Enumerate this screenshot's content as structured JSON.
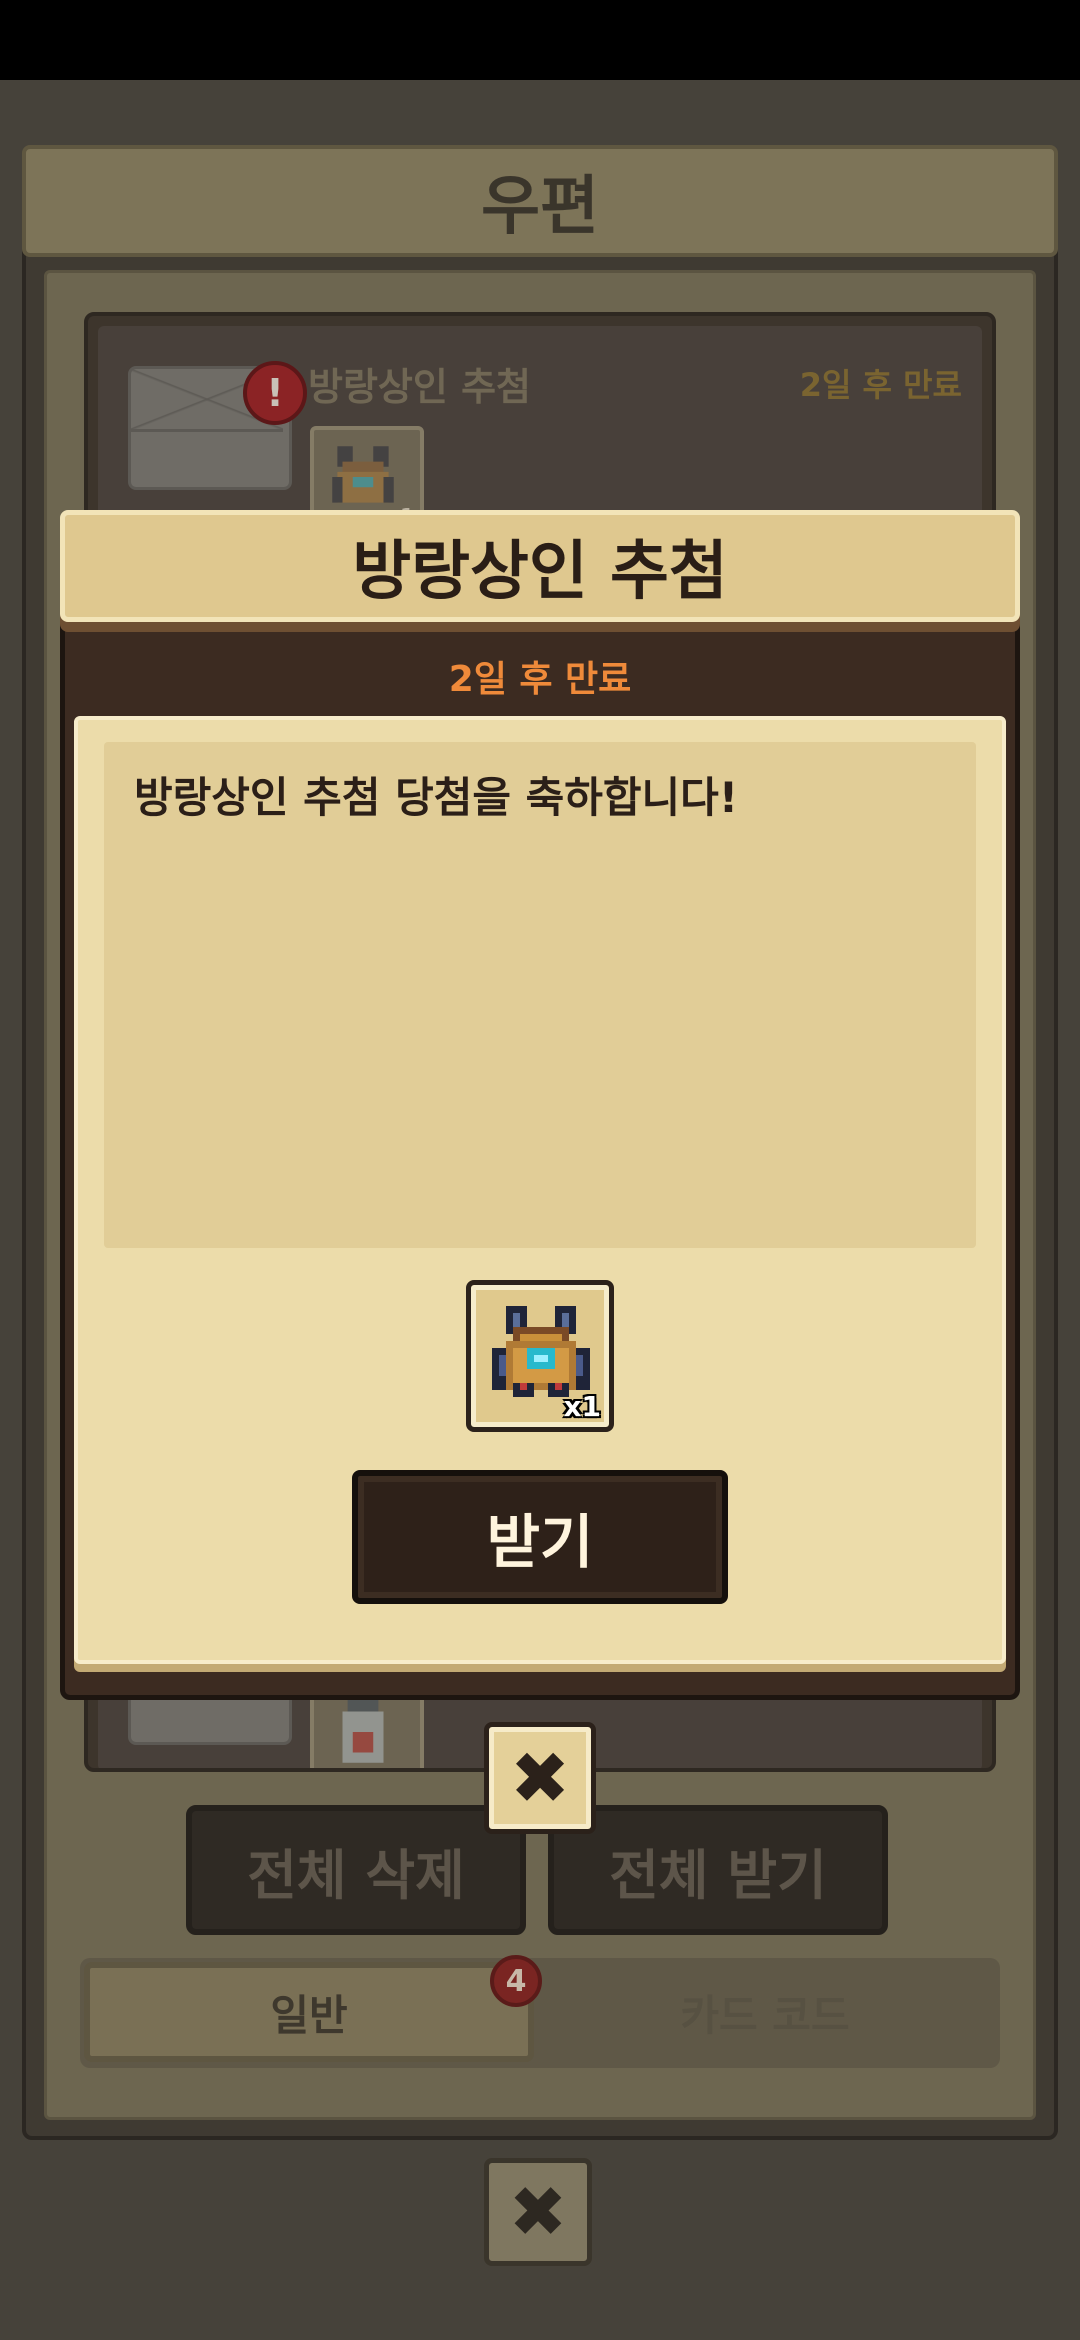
{
  "mailbox": {
    "title": "우편",
    "items": [
      {
        "title": "방랑상인 추첨",
        "expire": "2일 후 만료",
        "reward_qty": "x1"
      }
    ],
    "delete_all_label": "전체 삭제",
    "receive_all_label": "전체 받기",
    "tabs": [
      {
        "label": "일반",
        "badge": "4"
      },
      {
        "label": "카드 코드"
      }
    ],
    "close_icon": "✖"
  },
  "popup": {
    "title": "방랑상인 추첨",
    "expire": "2일 후 만료",
    "message": "방랑상인 추첨 당첨을 축하합니다!",
    "reward_qty": "x1",
    "receive_label": "받기",
    "close_icon": "✖"
  },
  "colors": {
    "popup_header": "#dfc88f",
    "popup_paper": "#ecdcaa",
    "expire_accent": "#ef8a3a",
    "button_dark": "#2e2119"
  }
}
